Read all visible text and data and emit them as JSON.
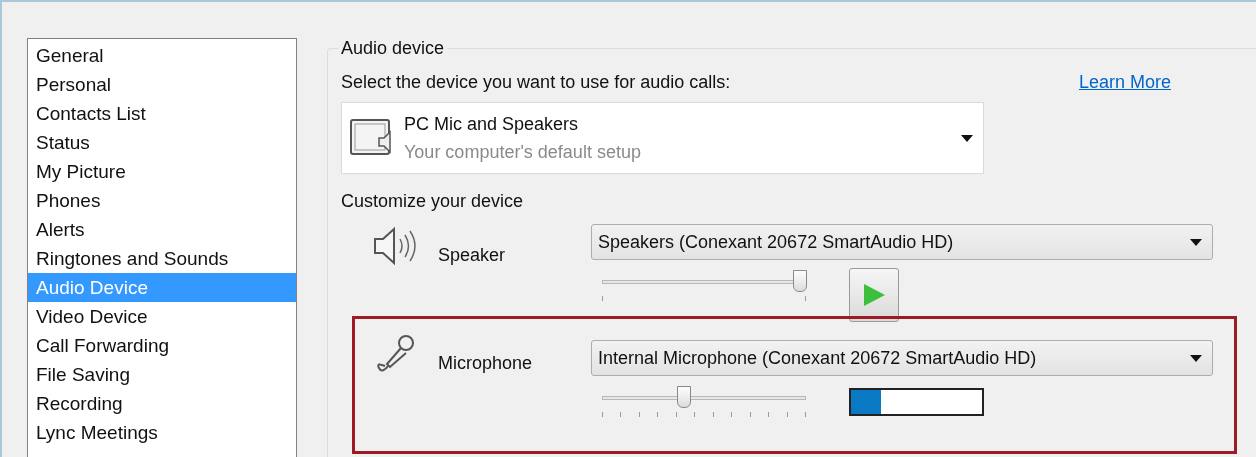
{
  "sidebar": {
    "items": [
      {
        "label": "General",
        "selected": false
      },
      {
        "label": "Personal",
        "selected": false
      },
      {
        "label": "Contacts List",
        "selected": false
      },
      {
        "label": "Status",
        "selected": false
      },
      {
        "label": "My Picture",
        "selected": false
      },
      {
        "label": "Phones",
        "selected": false
      },
      {
        "label": "Alerts",
        "selected": false
      },
      {
        "label": "Ringtones and Sounds",
        "selected": false
      },
      {
        "label": "Audio Device",
        "selected": true
      },
      {
        "label": "Video Device",
        "selected": false
      },
      {
        "label": "Call Forwarding",
        "selected": false
      },
      {
        "label": "File Saving",
        "selected": false
      },
      {
        "label": "Recording",
        "selected": false
      },
      {
        "label": "Lync Meetings",
        "selected": false
      }
    ]
  },
  "audio_device": {
    "group_title": "Audio device",
    "prompt": "Select the device you want to use for audio calls:",
    "learn_more": "Learn More",
    "device": {
      "name": "PC Mic and Speakers",
      "description": "Your computer's default setup"
    },
    "customize_title": "Customize your device",
    "speaker": {
      "label": "Speaker",
      "dropdown": "Speakers (Conexant 20672 SmartAudio HD)",
      "level": 0.97
    },
    "microphone": {
      "label": "Microphone",
      "dropdown": "Internal Microphone (Conexant 20672 SmartAudio HD)",
      "level": 0.4,
      "meter": {
        "level": 0.23
      }
    }
  }
}
